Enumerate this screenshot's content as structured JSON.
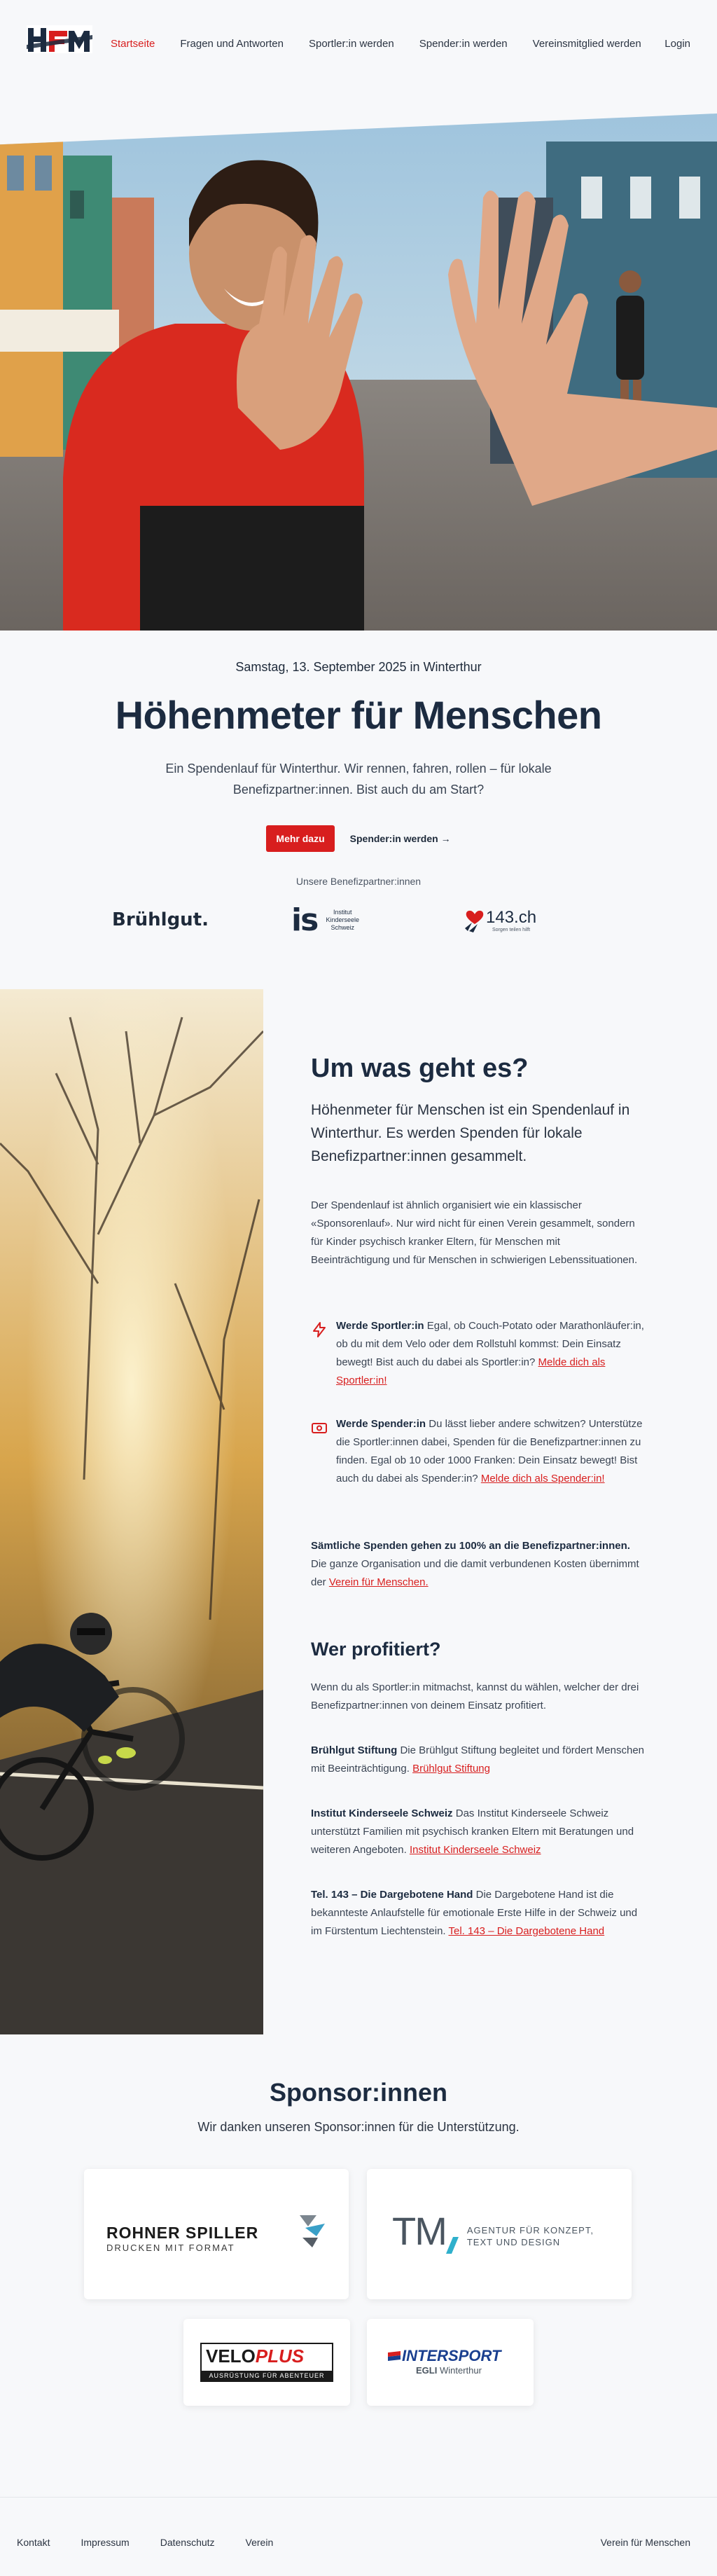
{
  "nav": {
    "logo_text": "HfM",
    "links": [
      "Startseite",
      "Fragen und Antworten",
      "Sportler:in werden",
      "Spender:in werden",
      "Vereinsmitglied werden"
    ],
    "login": "Login"
  },
  "hero": {
    "date": "Samstag, 13. September 2025 in Winterthur",
    "title": "Höhenmeter für Menschen",
    "lead": "Ein Spendenlauf für Winterthur. Wir rennen, fahren, rollen – für lokale Benefizpartner:innen. Bist auch du am Start?",
    "btn_primary": "Mehr dazu",
    "btn_secondary": "Spender:in werden →",
    "partners_label": "Unsere Benefizpartner:innen",
    "partner_logos": [
      "Brühlgut.",
      "is",
      "Institut Kinderseele Schweiz",
      "143.ch",
      "Sorgen teilen hilft"
    ]
  },
  "about": {
    "title": "Um was geht es?",
    "sub": "Höhenmeter für Menschen ist ein Spendenlauf in Winterthur. Es werden Spenden für lokale Benefizpartner:innen gesammelt.",
    "p1": "Der Spendenlauf ist ähnlich organisiert wie ein klassischer «Sponsorenlauf». Nur wird nicht für einen Verein gesammelt, sondern für Kinder psychisch kranker Eltern, für Menschen mit Beeinträchtigung und für Menschen in schwierigen Lebenssituationen.",
    "item1_bold": "Werde Sportler:in",
    "item1_text": " Egal, ob Couch-Potato oder Marathonläufer:in, ob du mit dem Velo oder dem Rollstuhl kommst: Dein Einsatz bewegt! Bist auch du dabei als Sportler:in? ",
    "item1_link": "Melde dich als Sportler:in!",
    "item2_bold": "Werde Spender:in",
    "item2_text": " Du lässt lieber andere schwitzen? Unterstütze die Sportler:innen dabei, Spenden für die Benefizpartner:innen zu finden. Egal ob 10 oder 1000 Franken: Dein Einsatz bewegt! Bist auch du dabei als Spender:in? ",
    "item2_link": "Melde dich als Spender:in!",
    "donation_bold": "Sämtliche Spenden gehen zu 100% an die Benefizpartner:innen.",
    "donation_text": " Die ganze Organisation und die damit verbundenen Kosten übernimmt der ",
    "donation_link": "Verein für Menschen.",
    "profit_title": "Wer profitiert?",
    "profit_intro": "Wenn du als Sportler:in mitmachst, kannst du wählen, welcher der drei Benefizpartner:innen von deinem Einsatz profitiert.",
    "partners": [
      {
        "name": "Brühlgut Stiftung",
        "text": " Die Brühlgut Stiftung begleitet und fördert Menschen mit Beeinträchtigung. ",
        "link": "Brühlgut Stiftung"
      },
      {
        "name": "Institut Kinderseele Schweiz",
        "text": " Das Institut Kinderseele Schweiz unterstützt Familien mit psychisch kranken Eltern mit Beratungen und weiteren Angeboten. ",
        "link": "Institut Kinderseele Schweiz"
      },
      {
        "name": "Tel. 143 – Die Dargebotene Hand",
        "text": " Die Dargebotene Hand ist die bekannteste Anlaufstelle für emotionale Erste Hilfe in der Schweiz und im Fürstentum Liechtenstein. ",
        "link": "Tel. 143 – Die Dargebotene Hand"
      }
    ]
  },
  "sponsors": {
    "title": "Sponsor:innen",
    "thanks": "Wir danken unseren Sponsor:innen für die Unterstützung.",
    "rohner_name": "ROHNER SPILLER",
    "rohner_tag": "DRUCKEN MIT FORMAT",
    "tm_name": "TM",
    "tm_tag1": "AGENTUR FÜR KONZEPT,",
    "tm_tag2": "TEXT UND DESIGN",
    "velo_a": "VELO",
    "velo_b": "PLUS",
    "velo_tag": "AUSRÜSTUNG FÜR ABENTEUER",
    "inter": "INTERSPORT",
    "inter_sub_a": "EGLI",
    "inter_sub_b": " Winterthur"
  },
  "footer": {
    "links": [
      "Kontakt",
      "Impressum",
      "Datenschutz",
      "Verein"
    ],
    "right": "Verein für Menschen"
  },
  "colors": {
    "accent": "#d81e1e",
    "navy": "#1c2b40",
    "bg": "#f7f8fa"
  }
}
